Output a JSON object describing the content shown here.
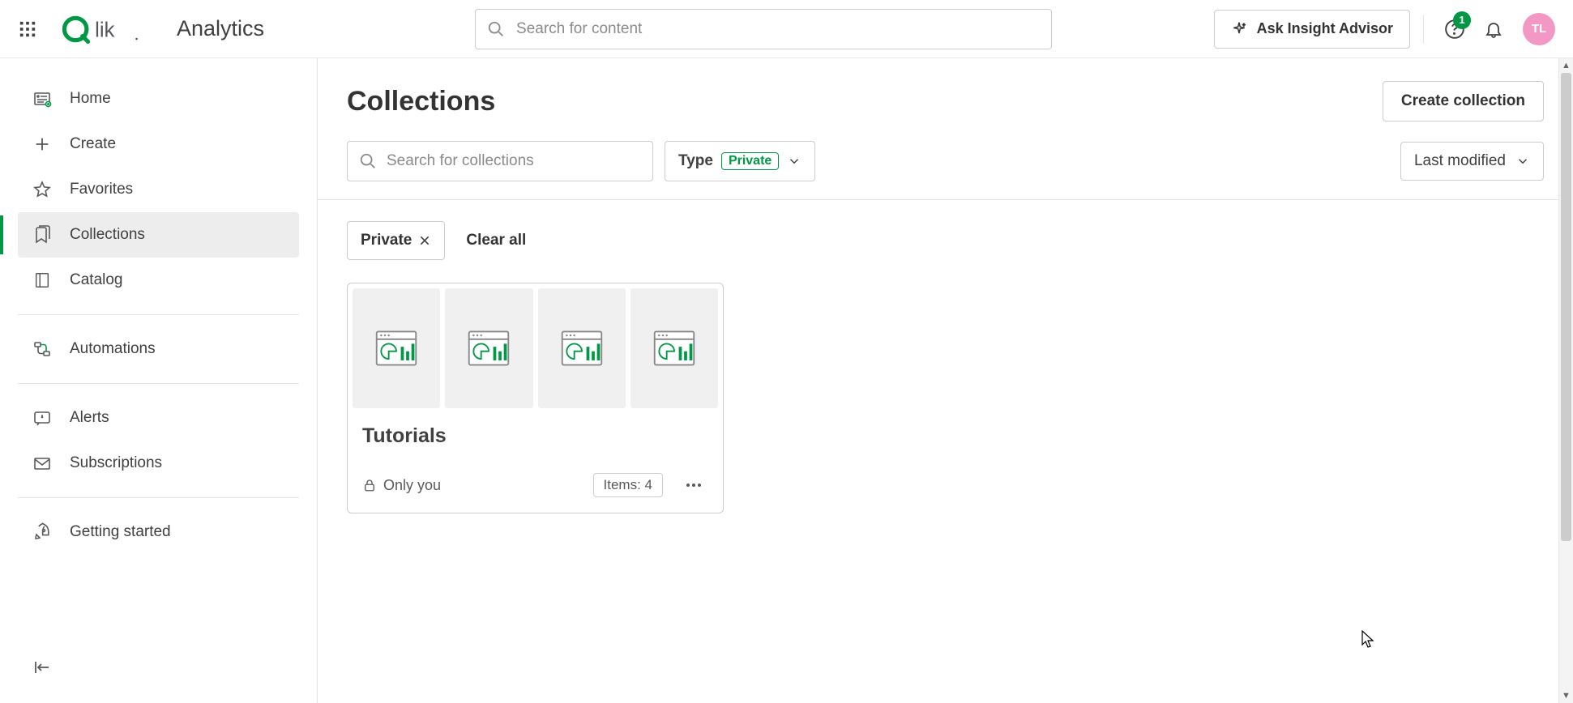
{
  "header": {
    "brand_name": "Analytics",
    "search_placeholder": "Search for content",
    "insight_label": "Ask Insight Advisor",
    "notifications_count": "1",
    "avatar_initials": "TL"
  },
  "sidebar": {
    "items": [
      {
        "label": "Home"
      },
      {
        "label": "Create"
      },
      {
        "label": "Favorites"
      },
      {
        "label": "Collections"
      },
      {
        "label": "Catalog"
      },
      {
        "label": "Automations"
      },
      {
        "label": "Alerts"
      },
      {
        "label": "Subscriptions"
      },
      {
        "label": "Getting started"
      }
    ]
  },
  "page": {
    "title": "Collections",
    "create_button": "Create collection",
    "search_placeholder": "Search for collections",
    "type_label": "Type",
    "type_value": "Private",
    "sort_label": "Last modified"
  },
  "filters": {
    "chip_label": "Private",
    "clear_all": "Clear all"
  },
  "cards": [
    {
      "title": "Tutorials",
      "visibility": "Only you",
      "items_label": "Items: 4"
    }
  ]
}
